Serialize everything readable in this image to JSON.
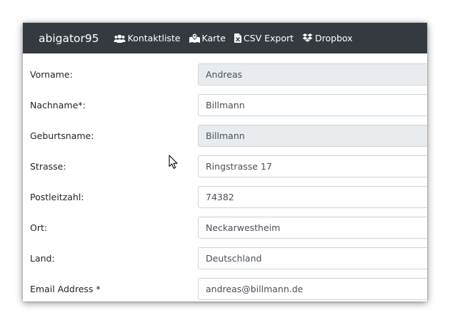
{
  "navbar": {
    "brand": "abigator95",
    "items": [
      {
        "label": "Kontaktliste",
        "icon": "users-icon"
      },
      {
        "label": "Karte",
        "icon": "map-marked-icon"
      },
      {
        "label": "CSV Export",
        "icon": "csv-file-icon"
      },
      {
        "label": "Dropbox",
        "icon": "dropbox-icon"
      }
    ]
  },
  "form": {
    "vorname": {
      "label": "Vorname:",
      "value": "Andreas",
      "readonly": true
    },
    "nachname": {
      "label": "Nachname*:",
      "value": "Billmann",
      "readonly": false
    },
    "geburtsname": {
      "label": "Geburtsname:",
      "value": "Billmann",
      "readonly": true
    },
    "strasse": {
      "label": "Strasse:",
      "value": "Ringstrasse 17",
      "readonly": false
    },
    "postleitzahl": {
      "label": "Postleitzahl:",
      "value": "74382",
      "readonly": false
    },
    "ort": {
      "label": "Ort:",
      "value": "Neckarwestheim",
      "readonly": false
    },
    "land": {
      "label": "Land:",
      "value": "Deutschland",
      "readonly": false
    },
    "email": {
      "label": "Email Address *",
      "value": "andreas@billmann.de",
      "readonly": false
    }
  },
  "colors": {
    "navbar_bg": "#343a40",
    "readonly_bg": "#e9ecef",
    "input_border": "#ced4da"
  }
}
